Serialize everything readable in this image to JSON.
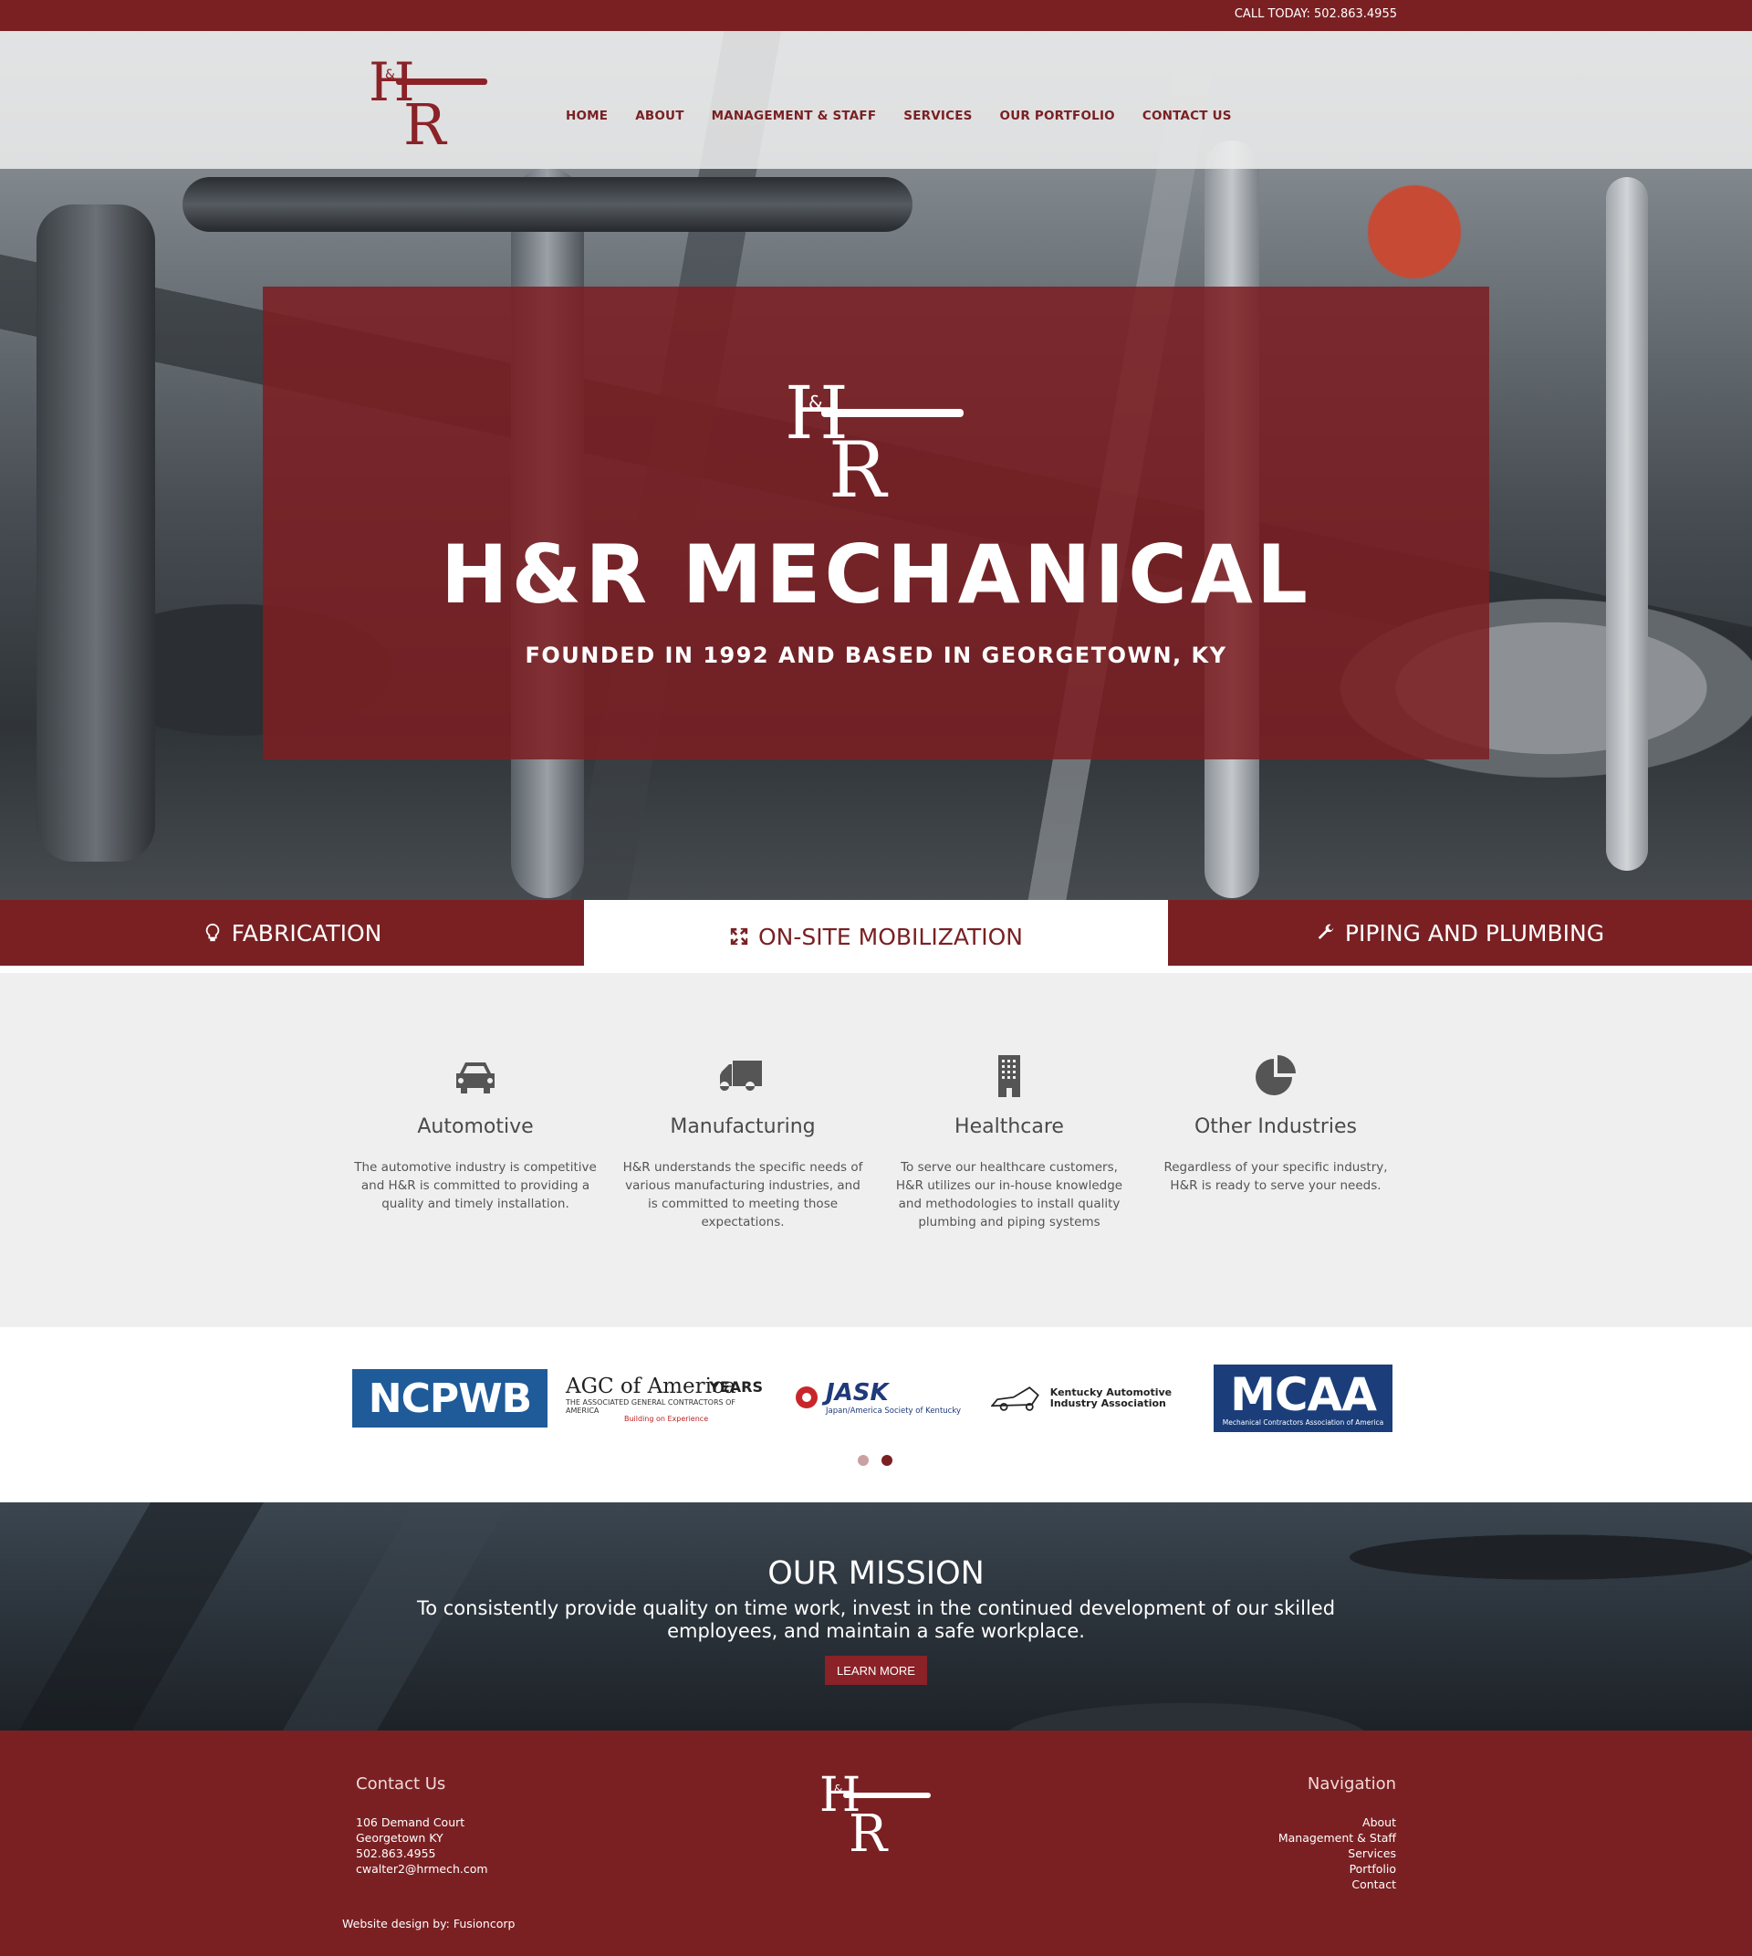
{
  "topbar": {
    "phone": "CALL TODAY: 502.863.4955"
  },
  "header": {
    "nav": [
      "HOME",
      "ABOUT",
      "MANAGEMENT & STAFF",
      "SERVICES",
      "OUR PORTFOLIO",
      "CONTACT US"
    ]
  },
  "hero": {
    "title": "H&R MECHANICAL",
    "subtitle": "FOUNDED IN 1992 AND BASED IN GEORGETOWN, KY"
  },
  "tabs": [
    {
      "label": "FABRICATION",
      "icon": "lightbulb-icon",
      "active": false
    },
    {
      "label": "ON-SITE MOBILIZATION",
      "icon": "arrows-expand-icon",
      "active": true
    },
    {
      "label": "PIPING AND PLUMBING",
      "icon": "wrench-icon",
      "active": false
    }
  ],
  "industries": [
    {
      "title": "Automotive",
      "icon": "car-icon",
      "text": "The automotive industry is competitive and H&R is committed to providing a quality and timely installation."
    },
    {
      "title": "Manufacturing",
      "icon": "truck-icon",
      "text": "H&R understands the specific needs of various manufacturing industries, and is committed to meeting those expectations."
    },
    {
      "title": "Healthcare",
      "icon": "building-icon",
      "text": "To serve our healthcare customers, H&R utilizes our in-house knowledge and methodologies to install quality plumbing and piping systems"
    },
    {
      "title": "Other Industries",
      "icon": "pie-chart-icon",
      "text": "Regardless of your specific industry, H&R is ready to serve your needs."
    }
  ],
  "partners": {
    "ncpwb": "NCPWB",
    "agc": {
      "name": "AGC of America",
      "tagline": "THE ASSOCIATED GENERAL CONTRACTORS OF AMERICA",
      "motto": "Building on Experience",
      "years": "YEARS"
    },
    "jask": {
      "name": "JASK",
      "tagline": "Japan/America Society of Kentucky"
    },
    "kaia": {
      "name": "Kentucky Automotive Industry Association"
    },
    "mcaa": {
      "name": "MCAA",
      "tagline": "Mechanical Contractors Association of America"
    }
  },
  "mission": {
    "title": "OUR MISSION",
    "text": "To consistently provide quality on time work, invest in the continued development of our skilled employees, and maintain a safe workplace.",
    "button": "LEARN MORE"
  },
  "footer": {
    "contact_heading": "Contact Us",
    "address1": "106 Demand Court",
    "address2": "Georgetown KY",
    "phone": "502.863.4955",
    "email": "cwalter2@hrmech.com",
    "nav_heading": "Navigation",
    "nav": [
      "About",
      "Management & Staff",
      "Services",
      "Portfolio",
      "Contact"
    ],
    "credit": "Website design by: Fusioncorp"
  },
  "colors": {
    "brand": "#7a2023",
    "light": "#efefef"
  }
}
